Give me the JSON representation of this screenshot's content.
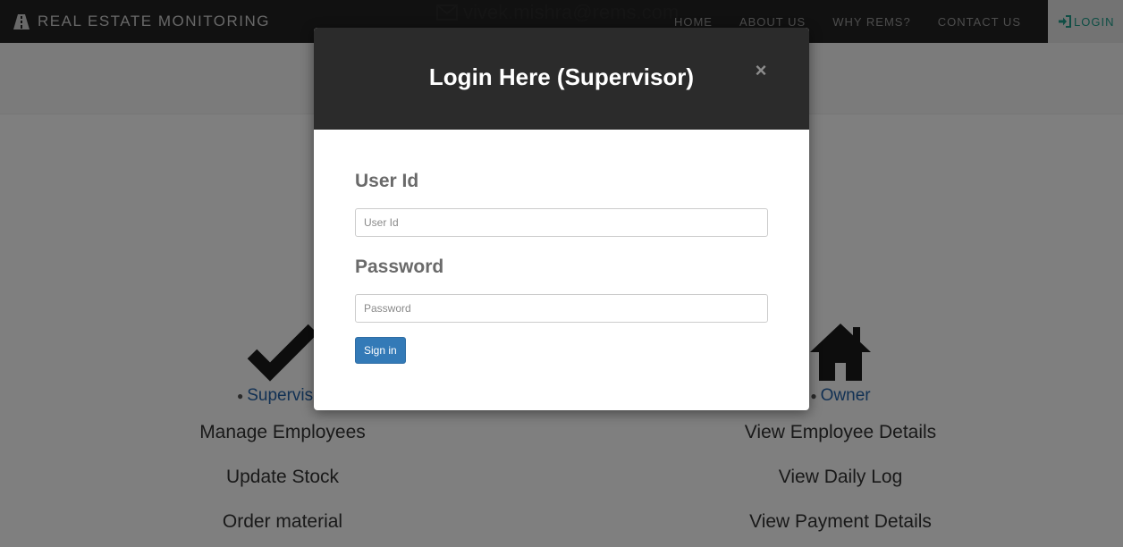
{
  "navbar": {
    "brand_text": "REAL ESTATE MONITORING",
    "brand_icon": "road-logo-icon",
    "email": "vivek.mishra@rems.com",
    "links": [
      "HOME",
      "ABOUT US",
      "WHY REMS?",
      "CONTACT US"
    ],
    "login_label": "LOGIN"
  },
  "roles": {
    "supervisor": {
      "title": "Supervisor",
      "icon": "checkmark-icon",
      "items": [
        "Manage Employees",
        "Update Stock",
        "Order material"
      ]
    },
    "owner": {
      "title": "Owner",
      "icon": "home-icon",
      "items": [
        "View Employee Details",
        "View Daily Log",
        "View Payment Details"
      ]
    }
  },
  "modal": {
    "title": "Login Here (Supervisor)",
    "close_glyph": "×",
    "user_label": "User Id",
    "user_placeholder": "User Id",
    "user_value": "",
    "password_label": "Password",
    "password_placeholder": "Password",
    "password_value": "",
    "signin_label": "Sign in"
  },
  "colors": {
    "navbar": "#222222",
    "modal_header": "#2b2b2b",
    "primary_button": "#337ab7",
    "login_accent": "#1e9c8a",
    "role_link": "#2563a8"
  }
}
